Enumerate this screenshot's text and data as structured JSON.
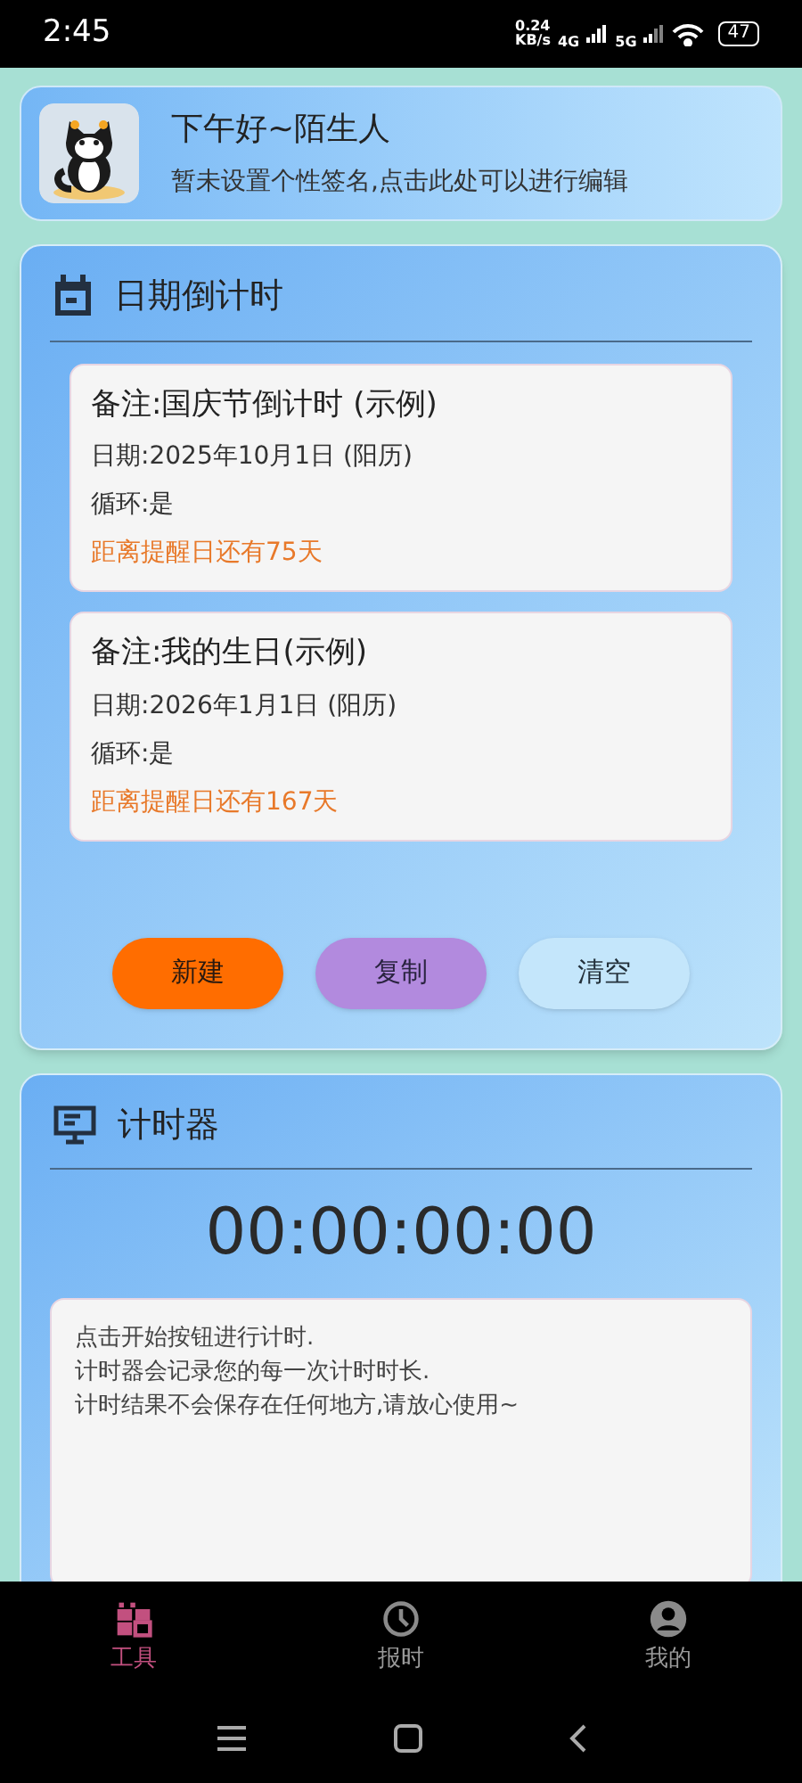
{
  "status_bar": {
    "time": "2:45",
    "speed_value": "0.24",
    "speed_unit": "KB/s",
    "network_1": "4G",
    "network_2": "5G",
    "battery": "47"
  },
  "profile": {
    "greeting": "下午好~陌生人",
    "signature": "暂未设置个性签名,点击此处可以进行编辑"
  },
  "countdown": {
    "title": "日期倒计时",
    "items": [
      {
        "note": "备注:国庆节倒计时 (示例)",
        "date": "日期:2025年10月1日 (阳历)",
        "repeat": "循环:是",
        "remaining": "距离提醒日还有75天"
      },
      {
        "note": "备注:我的生日(示例)",
        "date": "日期:2026年1月1日 (阳历)",
        "repeat": "循环:是",
        "remaining": "距离提醒日还有167天"
      }
    ],
    "buttons": [
      {
        "label": "新建",
        "kind": "primary"
      },
      {
        "label": "复制",
        "kind": "secondary"
      },
      {
        "label": "清空",
        "kind": "plain"
      }
    ]
  },
  "timer": {
    "title": "计时器",
    "display": "00:00:00:00",
    "log": [
      "点击开始按钮进行计时.",
      "计时器会记录您的每一次计时时长.",
      "计时结果不会保存在任何地方,请放心使用~"
    ]
  },
  "nav": [
    {
      "label": "工具",
      "selected": true
    },
    {
      "label": "报时",
      "selected": false
    },
    {
      "label": "我的",
      "selected": false
    }
  ]
}
